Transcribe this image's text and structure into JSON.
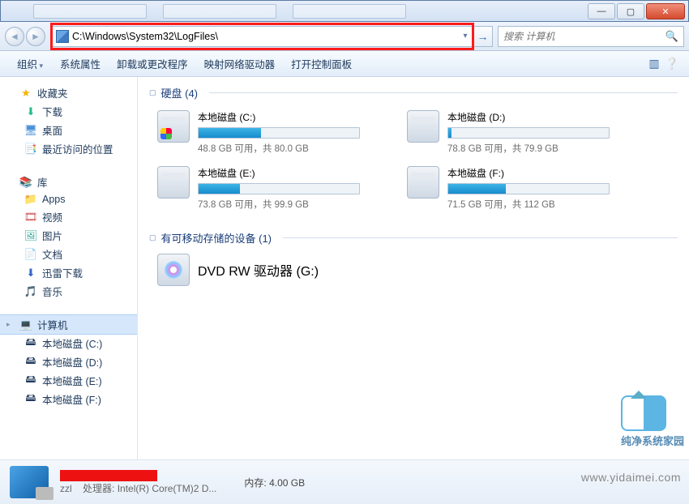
{
  "titlebar": {
    "min": "—",
    "max": "▢",
    "close": "✕"
  },
  "nav": {
    "back_glyph": "◄",
    "fwd_glyph": "►",
    "address": "C:\\Windows\\System32\\LogFiles\\",
    "drop_glyph": "▾",
    "go_glyph": "→"
  },
  "search": {
    "placeholder": "搜索 计算机",
    "icon": "🔍"
  },
  "toolbar": {
    "organize": "组织",
    "sys_properties": "系统属性",
    "uninstall": "卸载或更改程序",
    "map_drive": "映射网络驱动器",
    "control_panel": "打开控制面板",
    "view_icon": "▥",
    "help_icon": "❔"
  },
  "tree": {
    "favorites": {
      "label": "收藏夹",
      "star": "★"
    },
    "downloads": {
      "label": "下载",
      "icon": "⬇"
    },
    "desktop": {
      "label": "桌面",
      "icon": "🖥"
    },
    "recent": {
      "label": "最近访问的位置",
      "icon": "📑"
    },
    "libraries": {
      "label": "库",
      "icon": "📚"
    },
    "apps": {
      "label": "Apps",
      "icon": "📁"
    },
    "videos": {
      "label": "视频",
      "icon": "🎞"
    },
    "pictures": {
      "label": "图片",
      "icon": "🖼"
    },
    "documents": {
      "label": "文档",
      "icon": "📄"
    },
    "xunlei": {
      "label": "迅雷下载",
      "icon": "⬇"
    },
    "music": {
      "label": "音乐",
      "icon": "🎵"
    },
    "computer": {
      "label": "计算机",
      "icon": "💻"
    },
    "drv_c": "本地磁盘 (C:)",
    "drv_d": "本地磁盘 (D:)",
    "drv_e": "本地磁盘 (E:)",
    "drv_f": "本地磁盘 (F:)"
  },
  "sections": {
    "hdd": "硬盘 (4)",
    "removable": "有可移动存储的设备 (1)"
  },
  "drives": [
    {
      "name": "本地磁盘 (C:)",
      "sub": "48.8 GB 可用，共 80.0 GB",
      "pct": 39,
      "win": true
    },
    {
      "name": "本地磁盘 (D:)",
      "sub": "78.8 GB 可用，共 79.9 GB",
      "pct": 2,
      "win": false
    },
    {
      "name": "本地磁盘 (E:)",
      "sub": "73.8 GB 可用，共 99.9 GB",
      "pct": 26,
      "win": false
    },
    {
      "name": "本地磁盘 (F:)",
      "sub": "71.5 GB 可用，共 112 GB",
      "pct": 36,
      "win": false
    }
  ],
  "dvd": {
    "label": "DVD RW 驱动器 (G:)"
  },
  "details": {
    "user": "zzl",
    "cpu_label": "处理器:",
    "cpu_value": "Intel(R) Core(TM)2 D...",
    "mem_label": "内存:",
    "mem_value": "4.00 GB"
  },
  "watermark": {
    "brand": "纯净系统家园",
    "url": "www.yidaimei.com"
  }
}
